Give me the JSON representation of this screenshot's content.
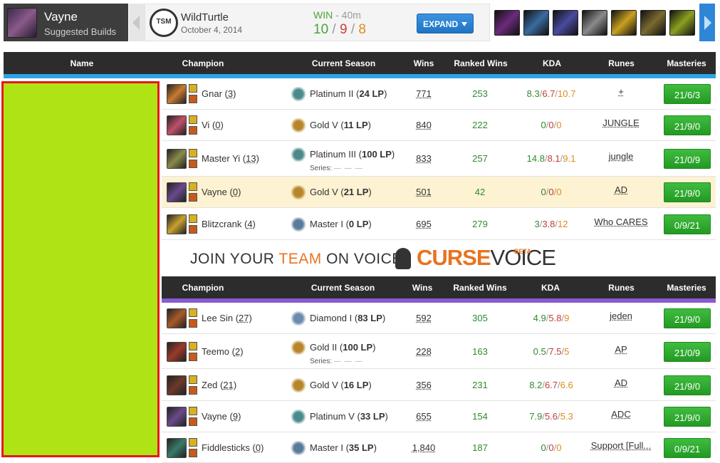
{
  "suggested": {
    "champion": "Vayne",
    "subtitle": "Suggested Builds"
  },
  "match": {
    "team_logo_text": "TSM",
    "player": "WildTurtle",
    "date": "October 4, 2014",
    "result": "WIN",
    "duration": " - 40m",
    "kills": "10",
    "deaths": "9",
    "assists": "8",
    "expand_label": "EXPAND"
  },
  "items": [
    {
      "icon": "sword-item-icon",
      "color": "#6b2a7a"
    },
    {
      "icon": "boots-item-icon",
      "color": "#3a6aa0"
    },
    {
      "icon": "blade-item-icon",
      "color": "#4a4aa0"
    },
    {
      "icon": "crossbow-item-icon",
      "color": "#8a8a8a"
    },
    {
      "icon": "runaans-item-icon",
      "color": "#c8a020"
    },
    {
      "icon": "bow-item-icon",
      "color": "#7a6a30"
    },
    {
      "icon": "trinket-item-icon",
      "color": "#8aa020"
    }
  ],
  "headers": {
    "name": "Name",
    "champion": "Champion",
    "season": "Current Season",
    "wins": "Wins",
    "ranked_wins": "Ranked Wins",
    "kda": "KDA",
    "runes": "Runes",
    "masteries": "Masteries"
  },
  "team1": [
    {
      "champion": "Gnar",
      "games": "3",
      "tier": "Platinum II",
      "lp": "24 LP",
      "series": false,
      "wins": "771",
      "ranked_wins": "253",
      "k": "8.3",
      "d": "6.7",
      "a": "10.7",
      "runes": "+",
      "masteries": "21/6/3",
      "color": "#c87a30",
      "rank_color": "#4a8a8a",
      "highlight": false
    },
    {
      "champion": "Vi",
      "games": "0",
      "tier": "Gold V",
      "lp": "11 LP",
      "series": false,
      "wins": "840",
      "ranked_wins": "222",
      "k": "0",
      "d": "0",
      "a": "0",
      "runes": "JUNGLE",
      "masteries": "21/9/0",
      "color": "#c0506a",
      "rank_color": "#b8862a",
      "highlight": false
    },
    {
      "champion": "Master Yi",
      "games": "13",
      "tier": "Platinum III",
      "lp": "100 LP",
      "series": true,
      "series_label": "Series:",
      "wins": "833",
      "ranked_wins": "257",
      "k": "14.8",
      "d": "8.1",
      "a": "9.1",
      "runes": "jungle",
      "masteries": "21/0/9",
      "color": "#8a8a4a",
      "rank_color": "#4a8a8a",
      "highlight": false
    },
    {
      "champion": "Vayne",
      "games": "0",
      "tier": "Gold V",
      "lp": "21 LP",
      "series": false,
      "wins": "501",
      "ranked_wins": "42",
      "k": "0",
      "d": "0",
      "a": "0",
      "runes": "AD",
      "masteries": "21/9/0",
      "color": "#6a4a8a",
      "rank_color": "#b8862a",
      "highlight": true
    },
    {
      "champion": "Blitzcrank",
      "games": "4",
      "tier": "Master I",
      "lp": "0 LP",
      "series": false,
      "wins": "695",
      "ranked_wins": "279",
      "k": "3",
      "d": "3.8",
      "a": "12",
      "runes": "Who CARES",
      "masteries": "0/9/21",
      "color": "#c8a030",
      "rank_color": "#5a7a9a",
      "highlight": false
    }
  ],
  "banner": {
    "join": "JOIN YOUR ",
    "team": "TEAM",
    "on_voice": " ON VOICE",
    "curse": "CURSE",
    "voice": "VOICE",
    "beta": "BETA"
  },
  "team2": [
    {
      "champion": "Lee Sin",
      "games": "27",
      "tier": "Diamond I",
      "lp": "83 LP",
      "series": false,
      "wins": "592",
      "ranked_wins": "305",
      "k": "4.9",
      "d": "5.8",
      "a": "9",
      "runes": "jeden",
      "masteries": "21/9/0",
      "color": "#a85a2a",
      "rank_color": "#6a8ab0",
      "highlight": false
    },
    {
      "champion": "Teemo",
      "games": "2",
      "tier": "Gold II",
      "lp": "100 LP",
      "series": true,
      "series_label": "Series:",
      "wins": "228",
      "ranked_wins": "163",
      "k": "0.5",
      "d": "7.5",
      "a": "5",
      "runes": "AP",
      "masteries": "21/0/9",
      "color": "#9a3a2a",
      "rank_color": "#b8862a",
      "highlight": false
    },
    {
      "champion": "Zed",
      "games": "21",
      "tier": "Gold V",
      "lp": "16 LP",
      "series": false,
      "wins": "356",
      "ranked_wins": "231",
      "k": "8.2",
      "d": "6.7",
      "a": "6.6",
      "runes": "AD",
      "masteries": "21/9/0",
      "color": "#6a3a2a",
      "rank_color": "#b8862a",
      "highlight": false
    },
    {
      "champion": "Vayne",
      "games": "9",
      "tier": "Platinum V",
      "lp": "33 LP",
      "series": false,
      "wins": "655",
      "ranked_wins": "154",
      "k": "7.9",
      "d": "5.6",
      "a": "5.3",
      "runes": "ADC",
      "masteries": "21/9/0",
      "color": "#6a4a8a",
      "rank_color": "#4a8a8a",
      "highlight": false
    },
    {
      "champion": "Fiddlesticks",
      "games": "0",
      "tier": "Master I",
      "lp": "35 LP",
      "series": false,
      "wins": "1,840",
      "ranked_wins": "187",
      "k": "0",
      "d": "0",
      "a": "0",
      "runes": "Support [Full...",
      "masteries": "0/9/21",
      "color": "#3a7a6a",
      "rank_color": "#5a7a9a",
      "highlight": false
    }
  ],
  "colors": {
    "team1_stripe": "#2ea3e6",
    "team2_stripe": "#8a5ad0",
    "redacted_block": "#afe314",
    "redacted_border": "#e8161f"
  }
}
